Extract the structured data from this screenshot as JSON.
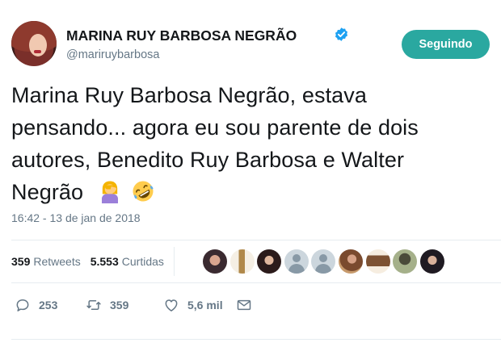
{
  "tweet": {
    "author": {
      "name": "MARINA RUY BARBOSA NEGRÃO",
      "handle": "@mariruybarbosa",
      "verified": true
    },
    "follow_button": "Seguindo",
    "text_lines": [
      "Marina Ruy Barbosa Negrão, estava",
      "pensando... agora eu sou parente de dois",
      "autores, Benedito Ruy Barbosa e Walter",
      "Negrão"
    ],
    "emojis": [
      "woman-facepalming-icon",
      "rolling-on-floor-laughing-icon"
    ],
    "timestamp": "16:42 - 13 de jan de 2018",
    "stats": {
      "retweets_count": "359",
      "retweets_label": "Retweets",
      "likes_count": "5.553",
      "likes_label": "Curtidas"
    },
    "actions": {
      "reply_count": "253",
      "retweet_count": "359",
      "like_count": "5,6 mil"
    }
  },
  "colors": {
    "follow_button_bg": "#2aa8a0",
    "verified_badge": "#1da1f2",
    "secondary_text": "#657786",
    "divider": "#e6ecf0"
  }
}
